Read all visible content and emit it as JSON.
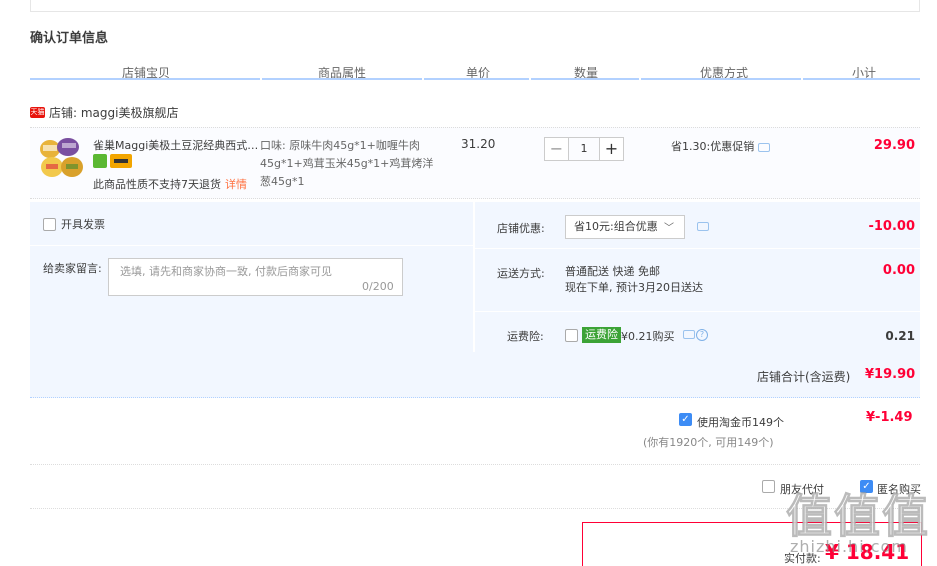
{
  "section": {
    "title": "确认订单信息"
  },
  "columns": [
    "店铺宝贝",
    "商品属性",
    "单价",
    "数量",
    "优惠方式",
    "小计"
  ],
  "shop": {
    "badge": "天猫",
    "label": "店铺: maggi美极旗舰店"
  },
  "item": {
    "title": "雀巢Maggi美极土豆泥经典西式…",
    "return_note": "此商品性质不支持7天退货",
    "detail_link": "详情",
    "attributes": "口味: 原味牛肉45g*1+咖喱牛肉45g*1+鸡茸玉米45g*1+鸡茸烤洋葱45g*1",
    "unit_price": "31.20",
    "quantity": "1",
    "qty_minus": "−",
    "qty_plus": "+",
    "promo": "省1.30:优惠促销",
    "subtotal": "29.90"
  },
  "invoice": {
    "label": "开具发票"
  },
  "message": {
    "label": "给卖家留言:",
    "placeholder": "选填, 请先和商家协商一致, 付款后商家可见",
    "count": "0/200"
  },
  "shop_discount": {
    "label": "店铺优惠:",
    "selected": "省10元:组合优惠",
    "arrow": "﹀",
    "amount": "-10.00"
  },
  "shipping": {
    "label": "运送方式:",
    "method": "普通配送 快递 免邮",
    "eta": "现在下单, 预计3月20日送达",
    "amount": "0.00"
  },
  "insurance": {
    "label": "运费险:",
    "tag": "运费险",
    "text": "¥0.21购买",
    "help": "?",
    "amount": "0.21"
  },
  "shop_total": {
    "label": "店铺合计(含运费)",
    "value": "¥19.90"
  },
  "taobao_coin": {
    "check": "✓",
    "label": "使用淘金币149个",
    "sub": "(你有1920个, 可用149个)",
    "value": "¥-1.49"
  },
  "options": {
    "friend_pay": "朋友代付",
    "anonymous_check": "✓",
    "anonymous": "匿名购买"
  },
  "payment": {
    "label": "实付款:",
    "value": "¥ 18.41"
  },
  "watermark": {
    "logo": "值值值",
    "site": "zhizhi.hi.com"
  }
}
